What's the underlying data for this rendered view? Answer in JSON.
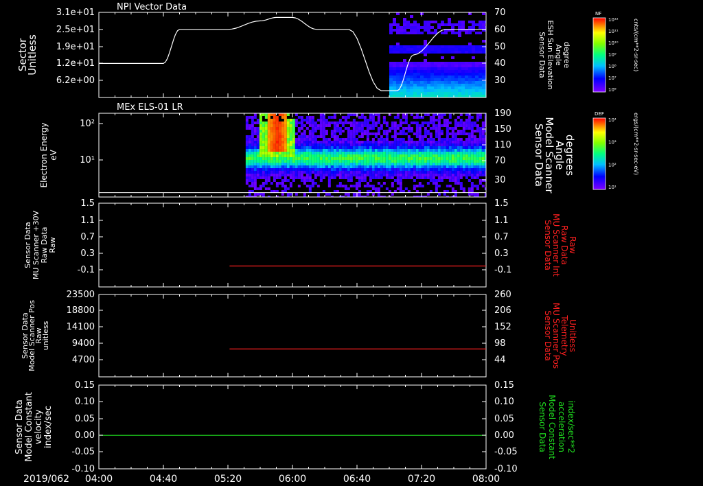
{
  "colors": {
    "background": "#000000",
    "axis": "#ffffff",
    "trace_white": "#ffffff",
    "trace_red": "#ff2020",
    "trace_green": "#20e020",
    "label_red": "#ff2020",
    "label_green": "#20e020"
  },
  "time_axis": {
    "date_label": "2019/062",
    "ticks": [
      "04:00",
      "04:40",
      "05:20",
      "06:00",
      "06:40",
      "07:20",
      "08:00"
    ],
    "start_min": 240,
    "end_min": 480
  },
  "colorbars": [
    {
      "title": "NF",
      "units": "cnts/(cm**2-sr-sec)",
      "tick_labels": [
        "10¹²",
        "10¹¹",
        "10¹⁰",
        "10⁹",
        "10⁸",
        "10⁷",
        "10⁶"
      ]
    },
    {
      "title": "DEF",
      "units": "ergs/(cm**2-sr-sec-eV)",
      "tick_labels": [
        "10⁴",
        "10³",
        "10²",
        "10¹"
      ]
    }
  ],
  "chart_data": [
    {
      "type": "heatmap",
      "title": "NPI Vector Data",
      "left_label": [
        "Sector",
        "Unitless"
      ],
      "left_ticks": [
        "3.1e+01",
        "2.5e+01",
        "1.9e+01",
        "1.2e+01",
        "6.2e+00"
      ],
      "right_label": [
        "Sensor Data",
        "ESH Sun Elevation",
        "Angle",
        "degree"
      ],
      "right_ticks": [
        "70",
        "60",
        "50",
        "40",
        "30"
      ],
      "right_ylim": [
        20,
        70
      ],
      "colorbar": "NF",
      "spectrogram_start_min": 420,
      "overlay_line": {
        "axis": "right",
        "x_min": [
          240,
          280,
          290,
          300,
          320,
          340,
          350,
          360,
          375,
          395,
          415,
          425,
          435,
          455,
          470,
          480
        ],
        "y": [
          40,
          40,
          60,
          60,
          60,
          65,
          67,
          67,
          60,
          60,
          24,
          24,
          45,
          60,
          60,
          60
        ]
      }
    },
    {
      "type": "heatmap",
      "title": "MEx ELS-01 LR",
      "left_label": [
        "Electron Energy",
        "eV"
      ],
      "left_ticks": [
        "10²",
        "10¹"
      ],
      "right_label": [
        "Sensor Data",
        "Model Scanner",
        "Angle",
        "degrees"
      ],
      "right_ticks": [
        "190",
        "150",
        "110",
        "70",
        "30"
      ],
      "right_ylim": [
        0,
        190
      ],
      "colorbar": "DEF",
      "spectrogram_start_min": 331,
      "burst_center_min": 350,
      "overlay_line": {
        "axis": "right",
        "x_min": [
          240,
          480
        ],
        "y": [
          10,
          10
        ]
      }
    },
    {
      "type": "line",
      "left_label": [
        "Sensor Data",
        "MU Scanner +30V",
        "Raw Data",
        "Raw"
      ],
      "left_ticks": [
        "1.5",
        "1.1",
        "0.7",
        "0.3",
        "-0.1"
      ],
      "left_ylim": [
        -0.5,
        1.5
      ],
      "right_label": [
        "Sensor Data",
        "MU Scanner Int",
        "Raw Data",
        "Raw"
      ],
      "right_ticks": [
        "1.5",
        "1.1",
        "0.7",
        "0.3",
        "-0.1"
      ],
      "right_label_color": "red",
      "series": [
        {
          "color": "red",
          "axis": "right",
          "x_min": [
            321,
            480
          ],
          "y": [
            0.0,
            0.0
          ]
        }
      ]
    },
    {
      "type": "line",
      "left_label": [
        "Sensor Data",
        "Model Scanner Pos",
        "Raw",
        "unitless"
      ],
      "left_ticks": [
        "23500",
        "18800",
        "14100",
        "9400",
        "4700"
      ],
      "left_ylim": [
        0,
        23500
      ],
      "right_label": [
        "Sensor Data",
        "MU Scanner Pos",
        "Telemetry",
        "Unitless"
      ],
      "right_ticks": [
        "260",
        "206",
        "152",
        "98",
        "44"
      ],
      "right_ylim": [
        0,
        260
      ],
      "right_label_color": "red",
      "series": [
        {
          "color": "red",
          "axis": "right",
          "x_min": [
            321,
            480
          ],
          "y": [
            88,
            88
          ]
        }
      ]
    },
    {
      "type": "line",
      "left_label": [
        "Sensor Data",
        "Model Constant",
        "velocity",
        "index/sec"
      ],
      "left_ticks": [
        "0.15",
        "0.10",
        "0.05",
        "0.00",
        "-0.05",
        "-0.10"
      ],
      "left_ylim": [
        -0.1,
        0.15
      ],
      "right_label": [
        "Sensor Data",
        "Model Constant",
        "acceleration",
        "index/sec**2"
      ],
      "right_ticks": [
        "0.15",
        "0.10",
        "0.05",
        "0.00",
        "-0.05",
        "-0.10"
      ],
      "right_label_color": "green",
      "series": [
        {
          "color": "green",
          "axis": "left",
          "x_min": [
            240,
            480
          ],
          "y": [
            0.0,
            0.0
          ]
        }
      ]
    }
  ]
}
